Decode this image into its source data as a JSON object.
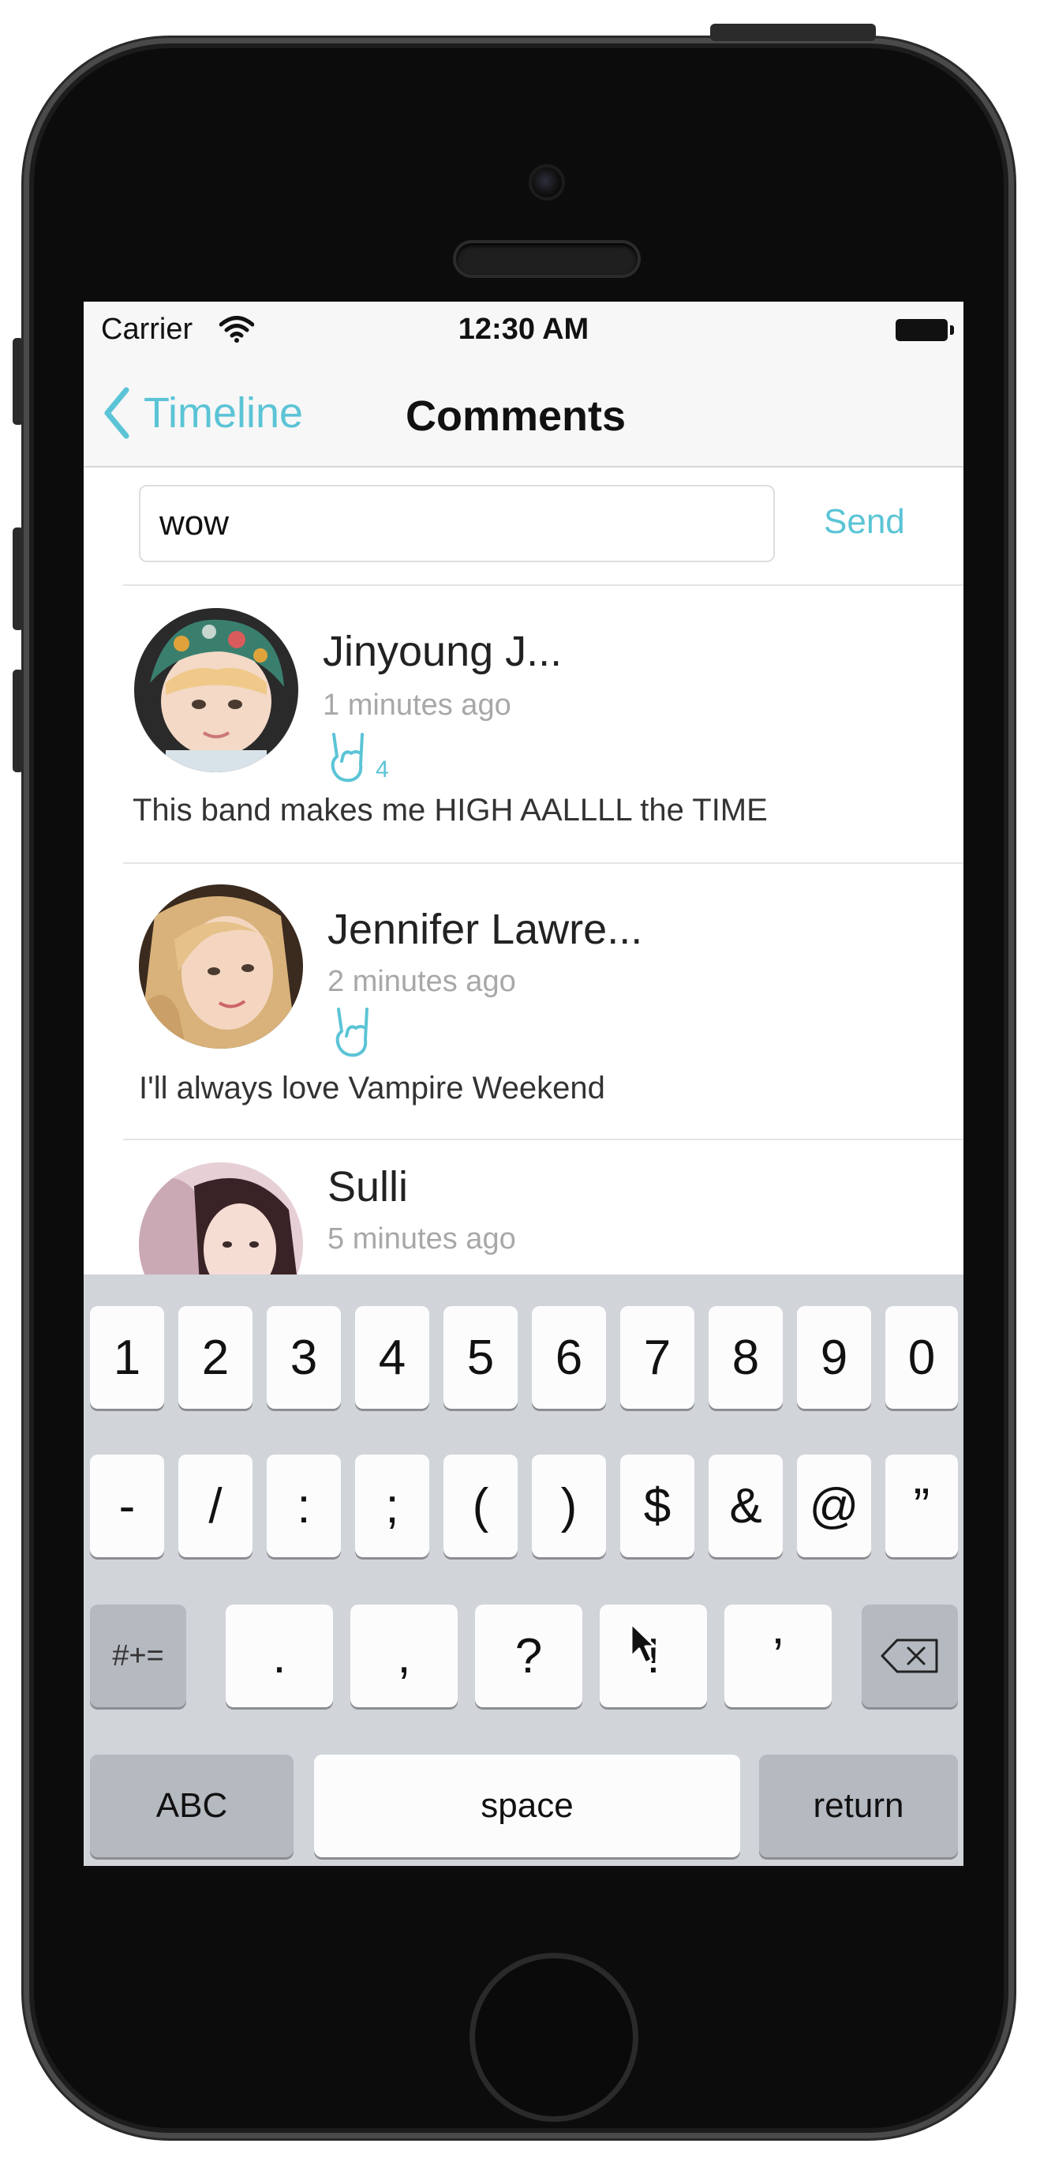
{
  "status_bar": {
    "carrier": "Carrier",
    "time": "12:30 AM"
  },
  "nav": {
    "back_label": "Timeline",
    "title": "Comments"
  },
  "compose": {
    "input_value": "wow",
    "send_label": "Send"
  },
  "comments": [
    {
      "name": "Jinyoung J...",
      "time": "1 minutes ago",
      "rock_count": "4",
      "text": "This band makes me HIGH AALLLL the TIME"
    },
    {
      "name": "Jennifer Lawre...",
      "time": "2 minutes ago",
      "text": "I'll always love Vampire Weekend"
    },
    {
      "name": "Sulli",
      "time": "5 minutes ago"
    }
  ],
  "keyboard": {
    "row1": [
      "1",
      "2",
      "3",
      "4",
      "5",
      "6",
      "7",
      "8",
      "9",
      "0"
    ],
    "row2": [
      "-",
      "/",
      ":",
      ";",
      "(",
      ")",
      "$",
      "&",
      "@",
      "”"
    ],
    "row3": {
      "mode": "#+=",
      "keys": [
        ".",
        ",",
        "?",
        "!",
        "’"
      ]
    },
    "row4": {
      "abc": "ABC",
      "space": "space",
      "return": "return"
    }
  },
  "colors": {
    "accent": "#5bc4d6",
    "keyboard_bg": "#d1d4d9",
    "key_dark": "#b5b9c0"
  }
}
